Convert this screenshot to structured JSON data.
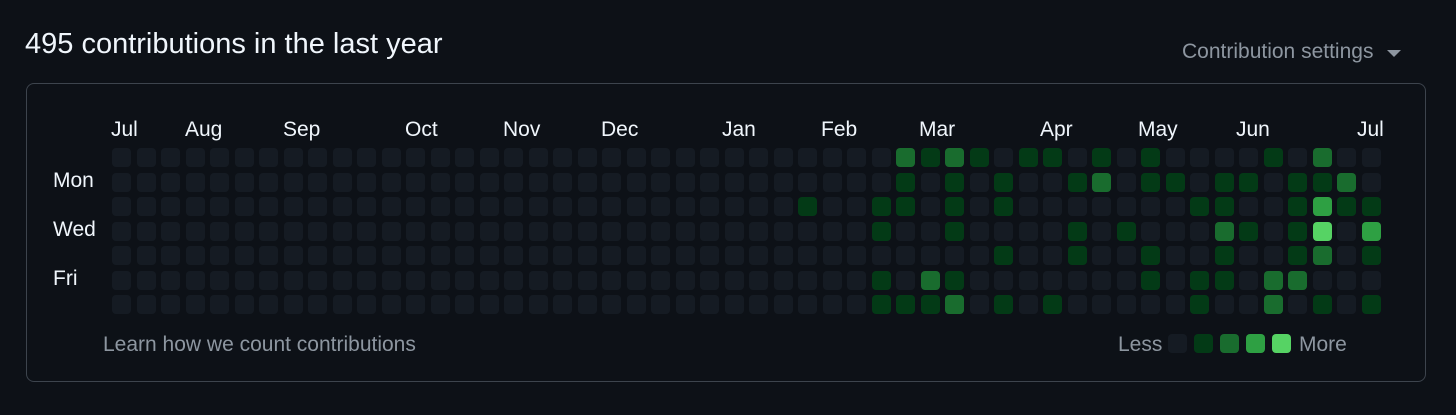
{
  "header": {
    "title": "495 contributions in the last year",
    "settings_label": "Contribution settings"
  },
  "calendar": {
    "months": [
      "Jul",
      "Aug",
      "Sep",
      "Oct",
      "Nov",
      "Dec",
      "Jan",
      "Feb",
      "Mar",
      "Apr",
      "May",
      "Jun",
      "Jul"
    ],
    "day_labels": [
      "Mon",
      "Wed",
      "Fri"
    ],
    "level_colors": [
      "#151b23",
      "#033a16",
      "#196c2e",
      "#2ea043",
      "#56d364"
    ],
    "weeks": [
      [
        0,
        0,
        0,
        0,
        0,
        0,
        0
      ],
      [
        0,
        0,
        0,
        0,
        0,
        0,
        0
      ],
      [
        0,
        0,
        0,
        0,
        0,
        0,
        0
      ],
      [
        0,
        0,
        0,
        0,
        0,
        0,
        0
      ],
      [
        0,
        0,
        0,
        0,
        0,
        0,
        0
      ],
      [
        0,
        0,
        0,
        0,
        0,
        0,
        0
      ],
      [
        0,
        0,
        0,
        0,
        0,
        0,
        0
      ],
      [
        0,
        0,
        0,
        0,
        0,
        0,
        0
      ],
      [
        0,
        0,
        0,
        0,
        0,
        0,
        0
      ],
      [
        0,
        0,
        0,
        0,
        0,
        0,
        0
      ],
      [
        0,
        0,
        0,
        0,
        0,
        0,
        0
      ],
      [
        0,
        0,
        0,
        0,
        0,
        0,
        0
      ],
      [
        0,
        0,
        0,
        0,
        0,
        0,
        0
      ],
      [
        0,
        0,
        0,
        0,
        0,
        0,
        0
      ],
      [
        0,
        0,
        0,
        0,
        0,
        0,
        0
      ],
      [
        0,
        0,
        0,
        0,
        0,
        0,
        0
      ],
      [
        0,
        0,
        0,
        0,
        0,
        0,
        0
      ],
      [
        0,
        0,
        0,
        0,
        0,
        0,
        0
      ],
      [
        0,
        0,
        0,
        0,
        0,
        0,
        0
      ],
      [
        0,
        0,
        0,
        0,
        0,
        0,
        0
      ],
      [
        0,
        0,
        0,
        0,
        0,
        0,
        0
      ],
      [
        0,
        0,
        0,
        0,
        0,
        0,
        0
      ],
      [
        0,
        0,
        0,
        0,
        0,
        0,
        0
      ],
      [
        0,
        0,
        0,
        0,
        0,
        0,
        0
      ],
      [
        0,
        0,
        0,
        0,
        0,
        0,
        0
      ],
      [
        0,
        0,
        0,
        0,
        0,
        0,
        0
      ],
      [
        0,
        0,
        0,
        0,
        0,
        0,
        0
      ],
      [
        0,
        0,
        0,
        0,
        0,
        0,
        0
      ],
      [
        0,
        0,
        1,
        0,
        0,
        0,
        0
      ],
      [
        0,
        0,
        0,
        0,
        0,
        0,
        0
      ],
      [
        0,
        0,
        0,
        0,
        0,
        0,
        0
      ],
      [
        0,
        0,
        1,
        1,
        0,
        1,
        1
      ],
      [
        2,
        1,
        1,
        0,
        0,
        0,
        1
      ],
      [
        1,
        0,
        0,
        0,
        0,
        2,
        1
      ],
      [
        2,
        1,
        1,
        1,
        0,
        1,
        2
      ],
      [
        1,
        0,
        0,
        0,
        0,
        0,
        0
      ],
      [
        0,
        1,
        1,
        0,
        1,
        0,
        1
      ],
      [
        1,
        0,
        0,
        0,
        0,
        0,
        0
      ],
      [
        1,
        0,
        0,
        0,
        0,
        0,
        1
      ],
      [
        0,
        1,
        0,
        1,
        1,
        0,
        0
      ],
      [
        1,
        2,
        0,
        0,
        0,
        0,
        0
      ],
      [
        0,
        0,
        0,
        1,
        0,
        0,
        0
      ],
      [
        1,
        1,
        0,
        0,
        1,
        1,
        0
      ],
      [
        0,
        1,
        0,
        0,
        0,
        0,
        0
      ],
      [
        0,
        0,
        1,
        0,
        0,
        1,
        1
      ],
      [
        0,
        1,
        1,
        2,
        1,
        1,
        0
      ],
      [
        0,
        1,
        0,
        1,
        0,
        0,
        0
      ],
      [
        1,
        0,
        0,
        0,
        0,
        2,
        2
      ],
      [
        0,
        1,
        1,
        1,
        1,
        2,
        0
      ],
      [
        2,
        1,
        3,
        4,
        2,
        0,
        1
      ],
      [
        0,
        2,
        1,
        0,
        0,
        0,
        0
      ],
      [
        0,
        0,
        1,
        3,
        1,
        0,
        1
      ]
    ],
    "learn_link": "Learn how we count contributions",
    "legend_less": "Less",
    "legend_more": "More"
  }
}
